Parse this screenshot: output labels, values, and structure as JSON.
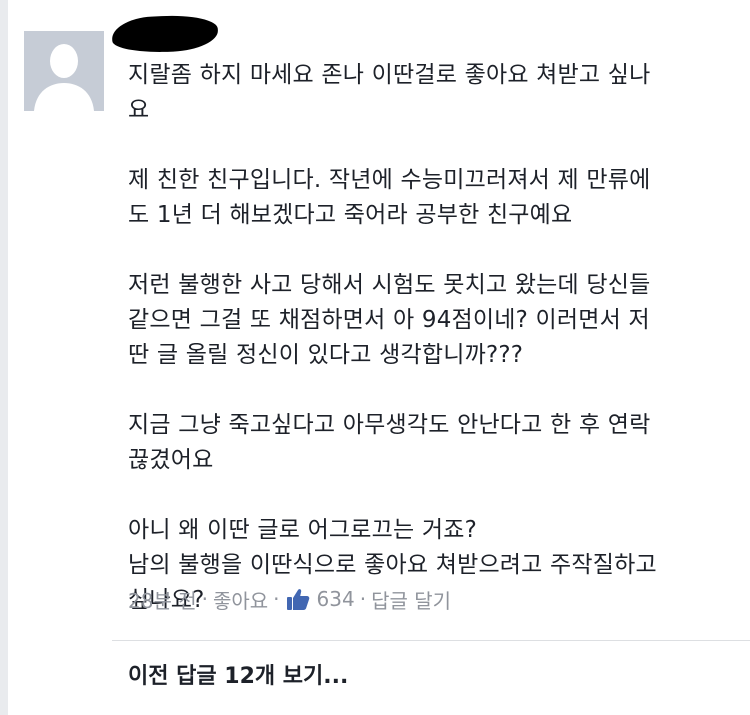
{
  "comment": {
    "paragraphs": [
      "지랄좀 하지 마세요 존나 이딴걸로 좋아요 쳐받고 싶나\n요",
      "제 친한 친구입니다. 작년에 수능미끄러져서 제 만류에\n도 1년 더 해보겠다고 죽어라 공부한 친구예요",
      "저런 불행한 사고 당해서 시험도 못치고 왔는데 당신들\n같으면 그걸 또 채점하면서 아 94점이네? 이러면서 저\n딴 글 올릴 정신이 있다고 생각합니까???",
      "지금 그냥 죽고싶다고 아무생각도 안난다고 한 후 연락\n끊겼어요",
      "아니 왜 이딴 글로 어그로끄는 거죠?\n남의 불행을 이딴식으로 좋아요 쳐받으려고 주작질하고\n싶나요?"
    ],
    "meta": {
      "time": "28분 전",
      "separator": "·",
      "like_action": "좋아요",
      "like_count": "634",
      "reply_action": "답글 달기"
    }
  },
  "view_previous_replies": "이전 답글 12개 보기...",
  "icons": {
    "avatar": "default-profile-silhouette-icon",
    "like": "thumbs-up-icon"
  },
  "colors": {
    "text": "#1d2129",
    "meta": "#90949c",
    "like_blue": "#4267b2",
    "avatar_bg": "#c6ccd6"
  }
}
